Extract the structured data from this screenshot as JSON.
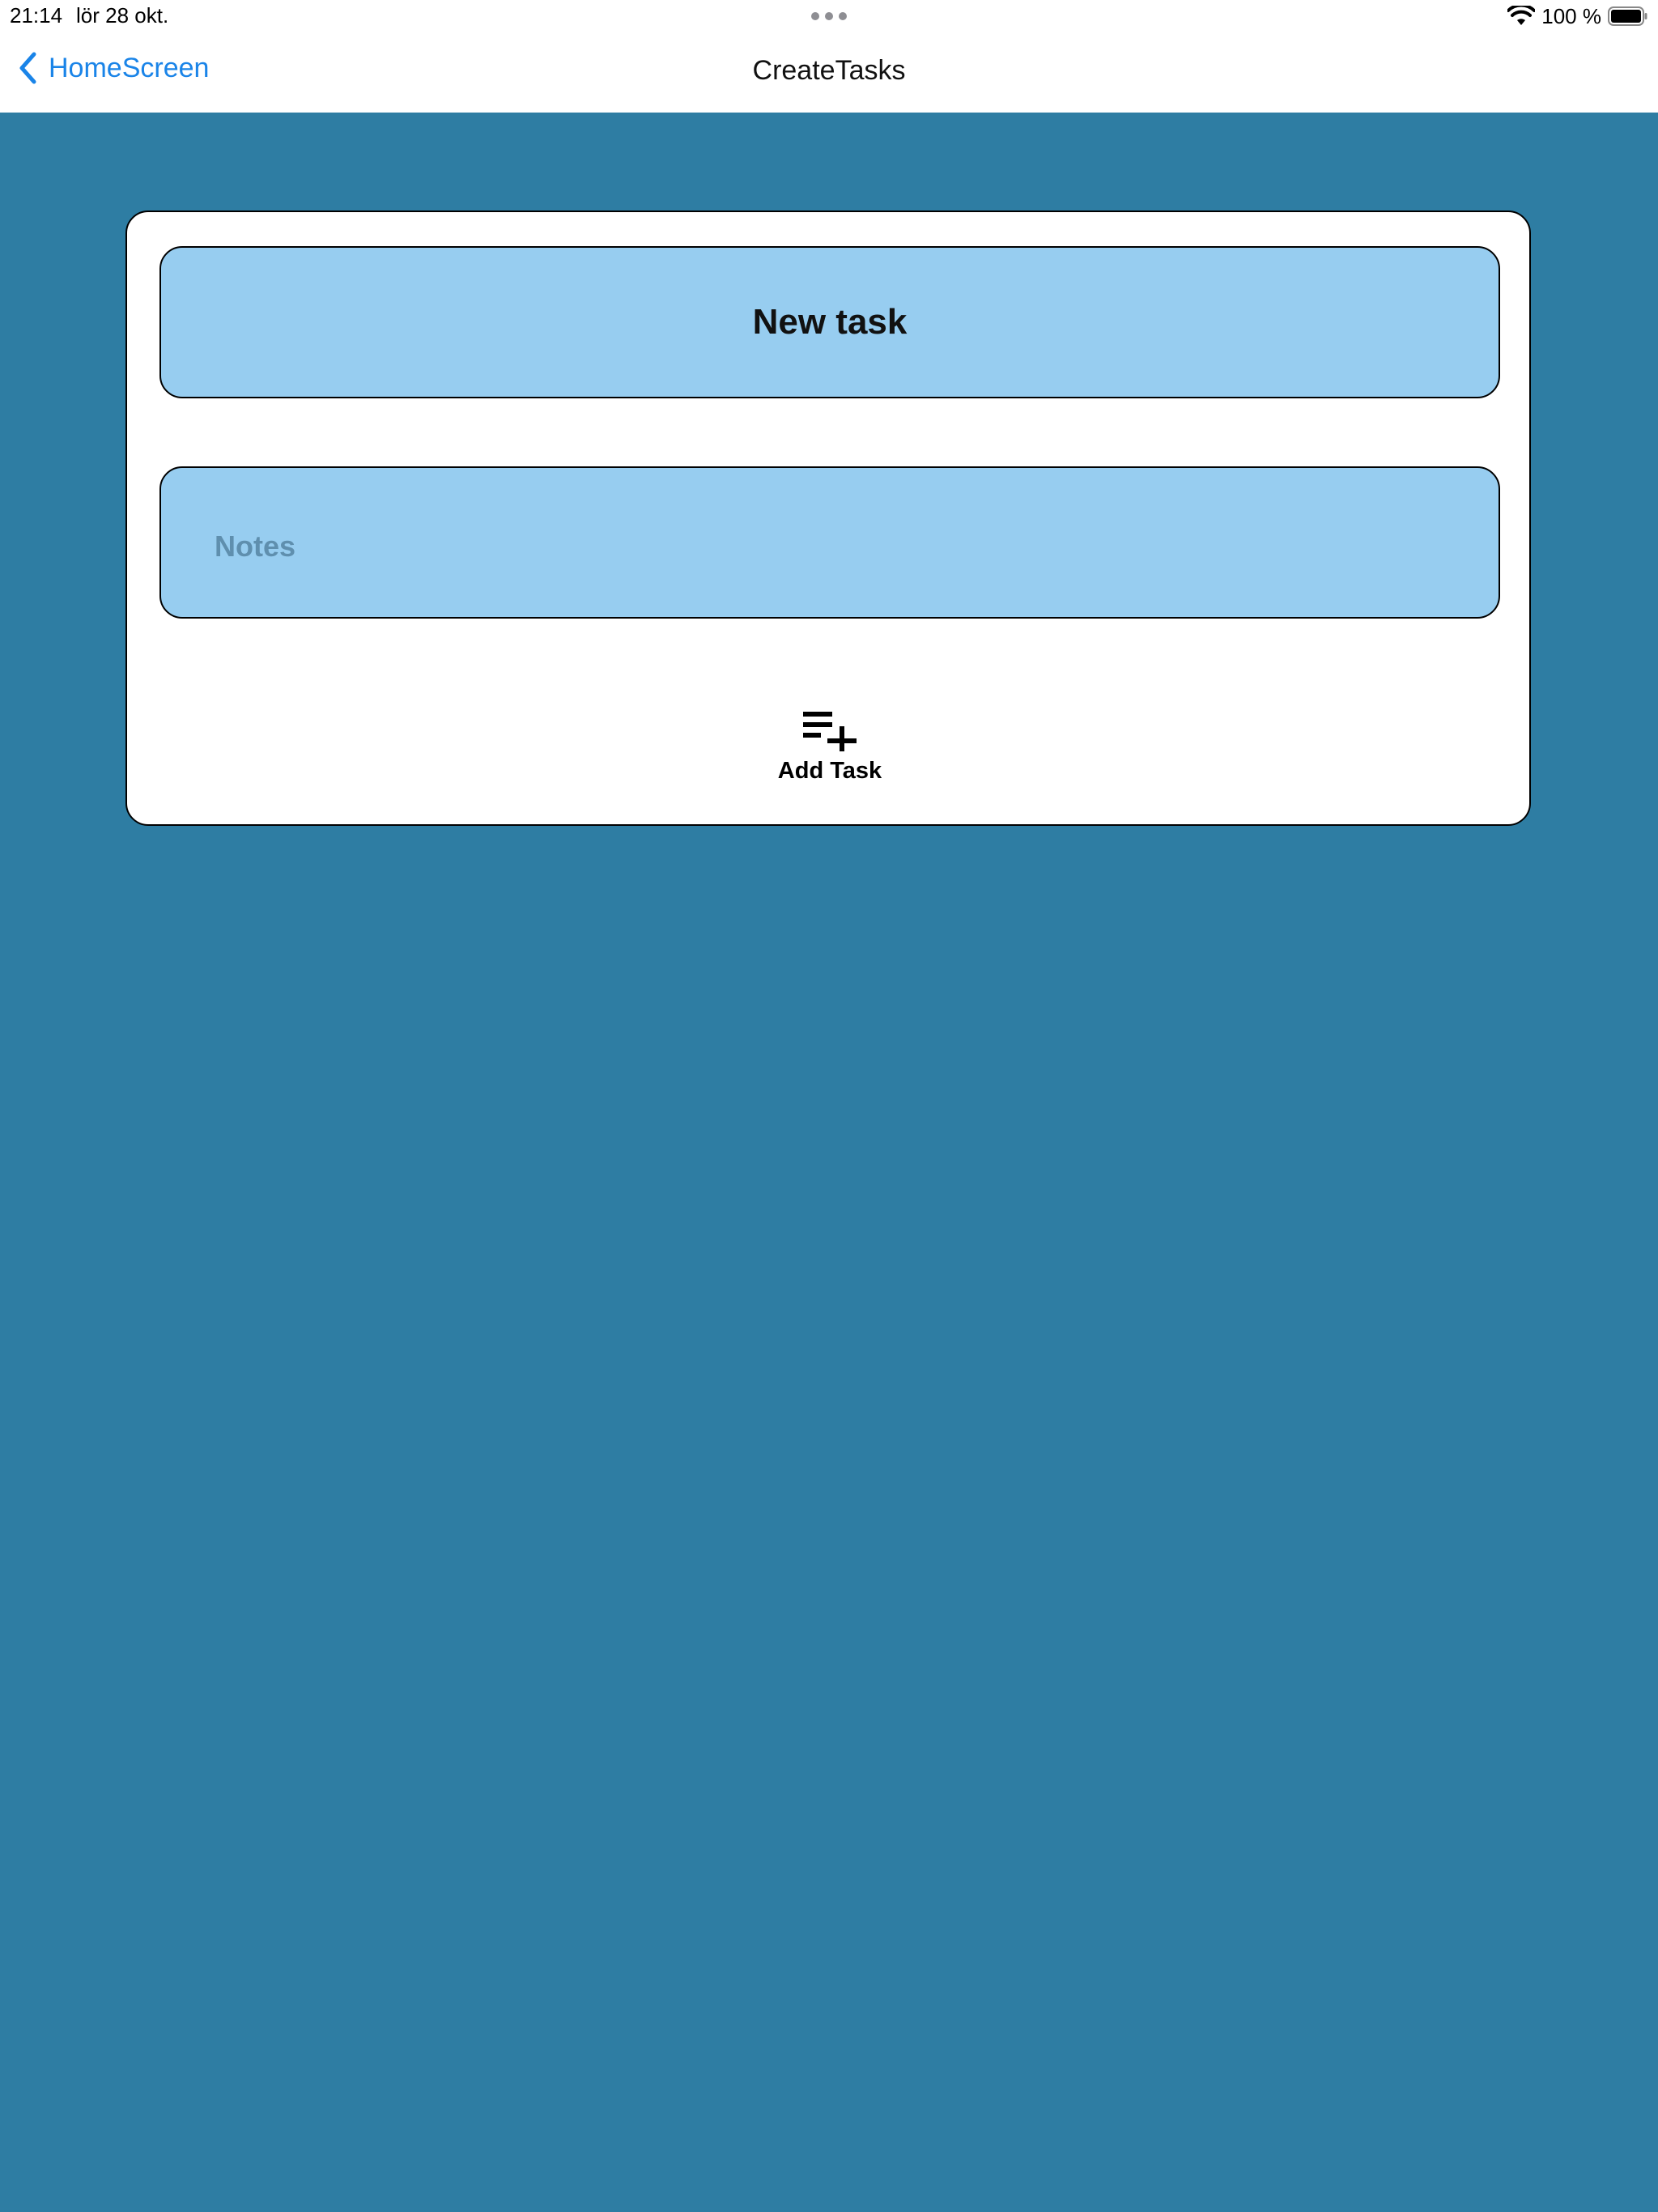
{
  "status_bar": {
    "time": "21:14",
    "date": "lör 28 okt.",
    "battery_percent": "100 %",
    "icons": [
      "wifi-icon",
      "battery-icon",
      "multitask-dots-icon"
    ]
  },
  "nav_bar": {
    "back_label": "HomeScreen",
    "title": "CreateTasks",
    "back_icon": "chevron-left-icon"
  },
  "form": {
    "title_value": "New task",
    "notes_value": "",
    "notes_placeholder": "Notes",
    "add_button_label": "Add Task",
    "add_button_icon": "playlist-add-icon"
  },
  "colors": {
    "background": "#2e7da3",
    "field_fill": "#97cdf0",
    "accent": "#1a84e8",
    "card": "#ffffff"
  }
}
